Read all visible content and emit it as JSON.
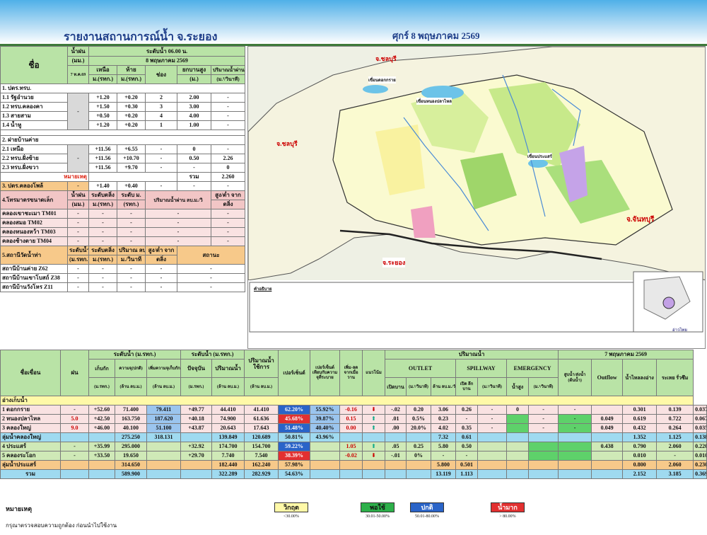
{
  "header": {
    "title": "รายงานสถานการณ์น้ำ จ.ระยอง",
    "date": "ศุกร์ 8 พฤษภาคม 2569"
  },
  "left": {
    "h_name": "ชื่อ",
    "h_rain": "น้ำฝน",
    "h_rain_unit": "(มม.)",
    "h_rain_time": "7 ท.ค.69",
    "h_level": "ระดับน้ำ 06.00 น.",
    "h_level_date": "8 พฤษภาคม 2569",
    "h_upper": "เหนือ",
    "h_lower": "ท้าย",
    "h_gate": "ช่อง",
    "h_raise": "ยกบานสูง",
    "h_flow": "ปริมาณน้ำผ่าน",
    "h_u_unit": "ม.(รทก.)",
    "h_l_unit": "ม.(รทก.)",
    "h_r_unit": "(ม.)",
    "h_f_unit": "(ม.³/วินาที)",
    "s1": "1. ปตร.ทรบ.",
    "rows1": [
      {
        "name": "1.1 รัฐอำนวย",
        "up": "+1.20",
        "lo": "+0.20",
        "gate": "2",
        "raise": "2.00",
        "flow": "-"
      },
      {
        "name": "1.2 ทรบ.คลองคา",
        "up": "+1.50",
        "lo": "+0.30",
        "gate": "3",
        "raise": "3.00",
        "flow": "-"
      },
      {
        "name": "1.3 สายสาม",
        "up": "+0.50",
        "lo": "+0.20",
        "gate": "4",
        "raise": "4.00",
        "flow": "-"
      },
      {
        "name": "1.4 น้ำหู",
        "up": "+1.20",
        "lo": "+0.20",
        "gate": "1",
        "raise": "1.00",
        "flow": "-"
      }
    ],
    "rain1": "-",
    "s2": "2. ฝายบ้านค่าย",
    "rows2": [
      {
        "name": "2.1 เหนือ",
        "up": "+11.56",
        "lo": "+6.55",
        "gate": "-",
        "raise": "0",
        "flow": "-"
      },
      {
        "name": "2.2 ทรบ.ฝั่งซ้าย",
        "up": "+11.56",
        "lo": "+10.70",
        "gate": "-",
        "raise": "0.50",
        "flow": "2.26"
      },
      {
        "name": "2.3 ทรบ.ฝั่งขวา",
        "up": "+11.56",
        "lo": "+9.70",
        "gate": "-",
        "raise": "-",
        "flow": "0"
      }
    ],
    "rain2": "-",
    "note": "หมายเหตุ",
    "total_label": "รวม",
    "total": "2.260",
    "s3": "3. ปตร.คลองโพล้",
    "s3_rain": "-",
    "s3_up": "+1.40",
    "s3_lo": "+0.40",
    "s3_g": "-",
    "s3_r": "-",
    "s3_f": "-",
    "s4": "4.โทรมาตรขนาดเล็ก",
    "h4_rain": "น้ำฝน",
    "h4_rain_u": "(มม.)",
    "h4_lvl": "ระดับตลิ่ง",
    "h4_lvl_u": "ม.(รทก.)",
    "h4_wl": "ระดับ ม.",
    "h4_wl_u": "(รทก.)",
    "h4_flow": "ปริมาณน้ำผ่าน ลบ.ม./วิ",
    "h4_diff": "สูง/ต่ำ จาก",
    "h4_diff2": "ตลิ่ง",
    "rows4": [
      {
        "name": "คลองเขาชะเมา",
        "code": "TM01"
      },
      {
        "name": "คลองสมอ",
        "code": "TM02"
      },
      {
        "name": "คลองหนองหว้า",
        "code": "TM03"
      },
      {
        "name": "คลองช้างตาย",
        "code": "TM04"
      }
    ],
    "s5": "5.สถานีวัดน้ำท่า",
    "h5_lvl": "ระดับน้ำ",
    "h5_lvl_u": "(ม.รทก.)",
    "h5_bank": "ระดับตลิ่ง",
    "h5_bank_u": "ม.(รทก.)",
    "h5_q": "ปริมาณ ลบ.",
    "h5_q_u": "ม./วินาที",
    "h5_diff": "สูง/ต่ำ จาก",
    "h5_diff2": "ตลิ่ง",
    "h5_status": "สถานะ",
    "rows5": [
      {
        "name": "สถานีบ้านค่าย Z62"
      },
      {
        "name": "สถานีบ้านเขาโบสถ์ Z38"
      },
      {
        "name": "สถานีบ้านวังโหร Z11"
      }
    ],
    "dash": "-"
  },
  "map": {
    "labels": [
      "จ.ชลบุรี",
      "จ.จันทบุรี",
      "จ.ระยอง",
      "จ.ชลบุรี",
      "เขื่อนหนองปลาไหล",
      "เขื่อนประแสร์",
      "เขื่อนดอกกราย",
      "คลองใหญ่",
      "อ่าวไทย"
    ],
    "legend_title": "คำอธิบาย"
  },
  "bottom": {
    "h_name": "ชื่อเขื่อน",
    "h_rain": "ฝน",
    "h_lvl": "ระดับน้ำ (ม.รทก.)",
    "h_lvl2": "ระดับน้ำ (ม.รทก.)",
    "h_cap": "ปริมาณน้ำใช้การ",
    "h_pct": "เปอร์เซ็นต์",
    "h_pct2": "เปอร์เซ็นต์ เทียบกับความจุที่ระบาย",
    "h_cmp1": "เพิ่ม-ลด จากเมื่อวาน",
    "h_cmp2": "แนวโน้ม",
    "h_outflow": "ปริมาณน้ำ",
    "h_outlet": "OUTLET",
    "h_spill": "SPILLWAY",
    "h_emer": "EMERGENCY",
    "h_date": "7 พฤษภาคม 2569",
    "h_normal": "เก็บกัก",
    "h_capn": "ความจุ(ปกติ)",
    "h_maxcap": "เพิ่มความจุเก็บกัก",
    "h_cur": "ปัจจุบัน",
    "h_vol": "ปริมาณน้ำ",
    "h_open": "เปิดบาน",
    "h_cms": "(ม.³/วินาที)",
    "h_mcm": "ล้าน ลบ.ม./วัน",
    "h_opens": "เปิด ลึก บาน",
    "h_cms2": "(ม.³/วินาที)",
    "h_height": "น้ำสูง",
    "h_pump": "สูบน้ำ/ส่งน้ำ (ต้นน้ำ)",
    "h_of": "Outflow",
    "h_canal": "น้ำไหลลงอ่าง",
    "h_evap": "ระเหย รั่วซึม",
    "u_m": "(ม.รทก.)",
    "u_mcm": "(ล้าน ลบ.ม.)",
    "u_pct": "",
    "u_mm": "",
    "sec1": "อ่างเก็บน้ำ",
    "rows": [
      {
        "name": "1 ดอกกราย",
        "rain": "-",
        "norm": "+52.60",
        "cap": "71.400",
        "maxc": "79.411",
        "cur": "+49.77",
        "vol": "44.410",
        "use": "41.410",
        "pct": "62.20%",
        "pct2": "55.92%",
        "chg": "-0.16",
        "arrow": "down",
        "trend": "-.02",
        "open": "0.20",
        "cms": "3.06",
        "mcm": "0.26",
        "sp1": "-",
        "sp2": "0",
        "em1": "-",
        "em2": "-",
        "pump": "",
        "of": "0.301",
        "canal": "0.139",
        "evap": "0.037"
      },
      {
        "name": "2 หนองปลาไหล",
        "rain": "5.0",
        "norm": "+42.50",
        "cap": "163.750",
        "maxc": "187.620",
        "cur": "+40.18",
        "vol": "74.900",
        "use": "61.636",
        "pct": "45.68%",
        "pct2": "39.87%",
        "chg": "0.15",
        "arrow": "up",
        "trend": ".01",
        "open": "0.5%",
        "cms": "0.23",
        "mcm": "-",
        "sp1": "-",
        "sp2": "",
        "em1": "-",
        "em2": "-",
        "pump": "0.049",
        "of": "0.619",
        "canal": "0.722",
        "evap": "0.067"
      },
      {
        "name": "3 คลองใหญ่",
        "rain": "9.0",
        "norm": "+46.00",
        "cap": "40.100",
        "maxc": "51.100",
        "cur": "+43.87",
        "vol": "20.643",
        "use": "17.643",
        "pct": "51.48%",
        "pct2": "40.40%",
        "chg": "0.00",
        "arrow": "up",
        "trend": ".00",
        "open": "20.0%",
        "cms": "4.02",
        "mcm": "0.35",
        "sp1": "-",
        "sp2": "",
        "em1": "-",
        "em2": "-",
        "pump": "0.049",
        "of": "0.432",
        "canal": "0.264",
        "evap": "0.035"
      }
    ],
    "sum1": {
      "name": "ลุ่มน้ำคลองใหญ่",
      "cap": "275.250",
      "maxc": "318.131",
      "vol": "139.849",
      "use": "120.689",
      "pct": "50.81%",
      "pct2": "43.96%",
      "cms": "7.32",
      "mcm": "0.61",
      "of": "1.352",
      "canal": "1.125",
      "evap": "0.138"
    },
    "rows2": [
      {
        "name": "4 ประแสร์",
        "rain": "-",
        "norm": "+35.99",
        "cap": "295.000",
        "cur": "+32.92",
        "vol": "174.700",
        "use": "154.700",
        "pct": "59.22%",
        "chg": "1.05",
        "arrow": "up",
        "trend": ".05",
        "open": "0.25",
        "cms": "5.80",
        "mcm": "0.50",
        "pump": "0.438",
        "of": "0.790",
        "canal": "2.060",
        "evap": "0.220"
      },
      {
        "name": "5 คลองระโอก",
        "rain": "-",
        "norm": "+33.50",
        "cap": "19.650",
        "cur": "+29.70",
        "vol": "7.740",
        "use": "7.540",
        "pct": "38.39%",
        "chg": "-0.02",
        "arrow": "down",
        "trend": "-.01",
        "open": "0%",
        "cms": "-",
        "mcm": "-",
        "pump": "",
        "of": "0.010",
        "canal": "-",
        "evap": "0.010"
      }
    ],
    "sum2": {
      "name": "ลุ่มน้ำประแสร์",
      "cap": "314.650",
      "vol": "182.440",
      "use": "162.240",
      "pct": "57.98%",
      "cms": "5.800",
      "mcm": "0.501",
      "of": "0.800",
      "canal": "2.060",
      "evap": "0.230"
    },
    "total": {
      "name": "รวม",
      "cap": "589.900",
      "vol": "322.289",
      "use": "282.929",
      "pct": "54.63%",
      "cms": "13.119",
      "mcm": "1.113",
      "of": "2.152",
      "canal": "3.185",
      "evap": "0.369"
    }
  },
  "legend": {
    "note": "หมายเหตุ",
    "sub": "กรุณาตรวจสอบความถูกต้อง ก่อนนำไปใช้งาน",
    "items": [
      {
        "label": "วิกฤต",
        "range": "<30.00%"
      },
      {
        "label": "พอใช้",
        "range": "30.01-50.00%"
      },
      {
        "label": "ปกติ",
        "range": "50.01-80.00%"
      },
      {
        "label": "น้ำมาก",
        "range": "> 80.00%"
      }
    ]
  },
  "colors": {
    "header": "#4fb0e8",
    "green_row": "#b9e3a6",
    "crit": "#fff9a8",
    "fair": "#5ed16a",
    "normal": "#2a64c8",
    "high": "#e23030"
  }
}
